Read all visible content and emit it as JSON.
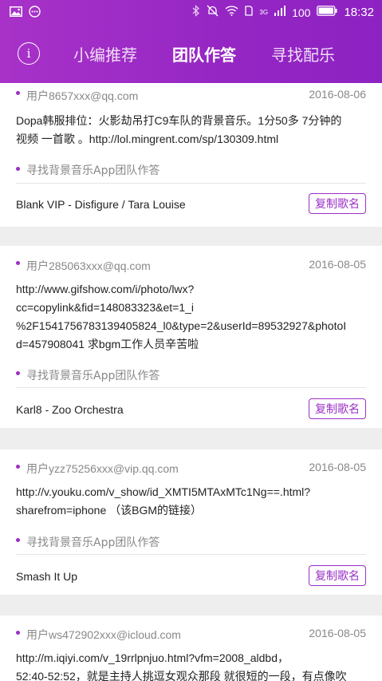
{
  "status_bar": {
    "network": "3G",
    "battery": "100",
    "time": "18:32",
    "icons": [
      "image-icon",
      "chat-icon",
      "bluetooth-icon",
      "mute-icon",
      "wifi-icon",
      "sim-icon",
      "signal-icon",
      "battery-icon"
    ]
  },
  "nav": {
    "info_label": "i",
    "tabs": [
      {
        "label": "小编推荐",
        "active": false
      },
      {
        "label": "团队作答",
        "active": true
      },
      {
        "label": "寻找配乐",
        "active": false
      }
    ]
  },
  "colors": {
    "accent": "#9b2fc7",
    "header": "#9526c4"
  },
  "posts": [
    {
      "user": "用户8657xxx@qq.com",
      "date": "2016-08-06",
      "lines": [
        "Dopa韩服排位：火影劫吊打C9车队的背景音乐。1分50多 7分钟的",
        "视频 一首歌 。http://lol.mingrent.com/sp/130309.html"
      ],
      "source": "寻找背景音乐App团队作答",
      "song": "Blank VIP - Disfigure / Tara Louise",
      "copy_label": "复制歌名"
    },
    {
      "user": "用户285063xxx@qq.com",
      "date": "2016-08-05",
      "lines": [
        "http://www.gifshow.com/i/photo/lwx?",
        "cc=copylink&fid=148083323&et=1_i",
        "%2F1541756783139405824_l0&type=2&userId=89532927&photoI",
        "d=457908041    求bgm工作人员辛苦啦"
      ],
      "source": "寻找背景音乐App团队作答",
      "song": "Karl8 - Zoo Orchestra",
      "copy_label": "复制歌名"
    },
    {
      "user": "用户yzz75256xxx@vip.qq.com",
      "date": "2016-08-05",
      "lines": [
        "http://v.youku.com/v_show/id_XMTI5MTAxMTc1Ng==.html?",
        "sharefrom=iphone （该BGM的链接）"
      ],
      "source": "寻找背景音乐App团队作答",
      "song": "Smash It Up",
      "copy_label": "复制歌名"
    },
    {
      "user": "用户ws472902xxx@icloud.com",
      "date": "2016-08-05",
      "lines": [
        "http://m.iqiyi.com/v_19rrlpnjuo.html?vfm=2008_aldbd，",
        "52:40-52:52，就是主持人挑逗女观众那段  就很短的一段，有点像吹"
      ],
      "source": "",
      "song": "",
      "copy_label": ""
    }
  ]
}
